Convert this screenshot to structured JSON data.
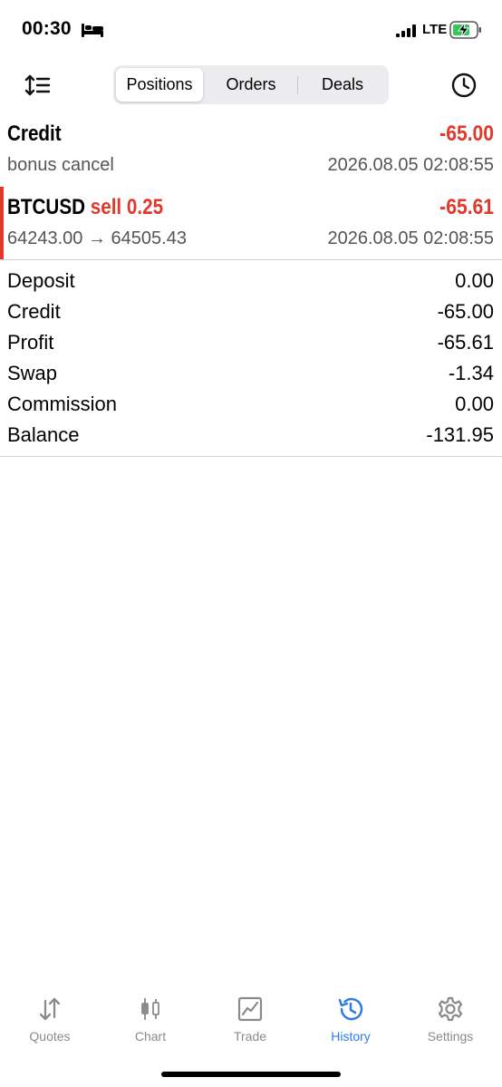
{
  "status_bar": {
    "time": "00:30",
    "network": "LTE"
  },
  "toolbar": {
    "tabs": [
      {
        "label": "Positions",
        "active": true
      },
      {
        "label": "Orders",
        "active": false
      },
      {
        "label": "Deals",
        "active": false
      }
    ]
  },
  "history": [
    {
      "title": "Credit",
      "amount": "-65.00",
      "detail": "bonus cancel",
      "time": "2026.08.05 02:08:55"
    },
    {
      "symbol": "BTCUSD",
      "side": "sell 0.25",
      "amount": "-65.61",
      "detail": "64243.00 → 64505.43",
      "time": "2026.08.05 02:08:55"
    }
  ],
  "summary": [
    {
      "label": "Deposit",
      "value": "0.00"
    },
    {
      "label": "Credit",
      "value": "-65.00"
    },
    {
      "label": "Profit",
      "value": "-65.61"
    },
    {
      "label": "Swap",
      "value": "-1.34"
    },
    {
      "label": "Commission",
      "value": "0.00"
    },
    {
      "label": "Balance",
      "value": "-131.95"
    }
  ],
  "tab_bar": [
    {
      "label": "Quotes",
      "icon": "quotes-icon",
      "active": false
    },
    {
      "label": "Chart",
      "icon": "chart-icon",
      "active": false
    },
    {
      "label": "Trade",
      "icon": "trade-icon",
      "active": false
    },
    {
      "label": "History",
      "icon": "history-icon",
      "active": true
    },
    {
      "label": "Settings",
      "icon": "settings-icon",
      "active": false
    }
  ],
  "colors": {
    "loss": "#e0392b",
    "active_tab": "#2f7be4",
    "inactive_tab": "#8a8a8e"
  }
}
